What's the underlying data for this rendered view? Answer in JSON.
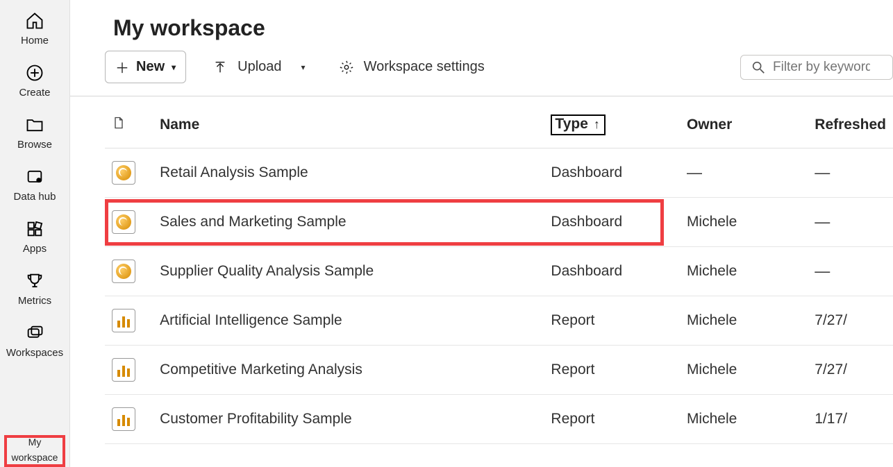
{
  "sidebar": {
    "items": [
      {
        "label": "Home"
      },
      {
        "label": "Create"
      },
      {
        "label": "Browse"
      },
      {
        "label": "Data hub"
      },
      {
        "label": "Apps"
      },
      {
        "label": "Metrics"
      },
      {
        "label": "Workspaces"
      }
    ],
    "bottom": {
      "line1": "My",
      "line2": "workspace"
    }
  },
  "header": {
    "title": "My workspace"
  },
  "toolbar": {
    "new": "New",
    "upload": "Upload",
    "settings": "Workspace settings",
    "filter_placeholder": "Filter by keyword"
  },
  "columns": {
    "name": "Name",
    "type": "Type",
    "owner": "Owner",
    "refreshed": "Refreshed"
  },
  "rows": [
    {
      "icon": "dashboard",
      "name": "Retail Analysis Sample",
      "type": "Dashboard",
      "owner": "—",
      "refreshed": "—",
      "highlight": false
    },
    {
      "icon": "dashboard",
      "name": "Sales and Marketing Sample",
      "type": "Dashboard",
      "owner": "Michele",
      "refreshed": "—",
      "highlight": true
    },
    {
      "icon": "dashboard",
      "name": "Supplier Quality Analysis Sample",
      "type": "Dashboard",
      "owner": "Michele",
      "refreshed": "—",
      "highlight": false
    },
    {
      "icon": "report",
      "name": "Artificial Intelligence Sample",
      "type": "Report",
      "owner": "Michele",
      "refreshed": "7/27/",
      "highlight": false
    },
    {
      "icon": "report",
      "name": "Competitive Marketing Analysis",
      "type": "Report",
      "owner": "Michele",
      "refreshed": "7/27/",
      "highlight": false
    },
    {
      "icon": "report",
      "name": "Customer Profitability Sample",
      "type": "Report",
      "owner": "Michele",
      "refreshed": "1/17/",
      "highlight": false
    }
  ]
}
